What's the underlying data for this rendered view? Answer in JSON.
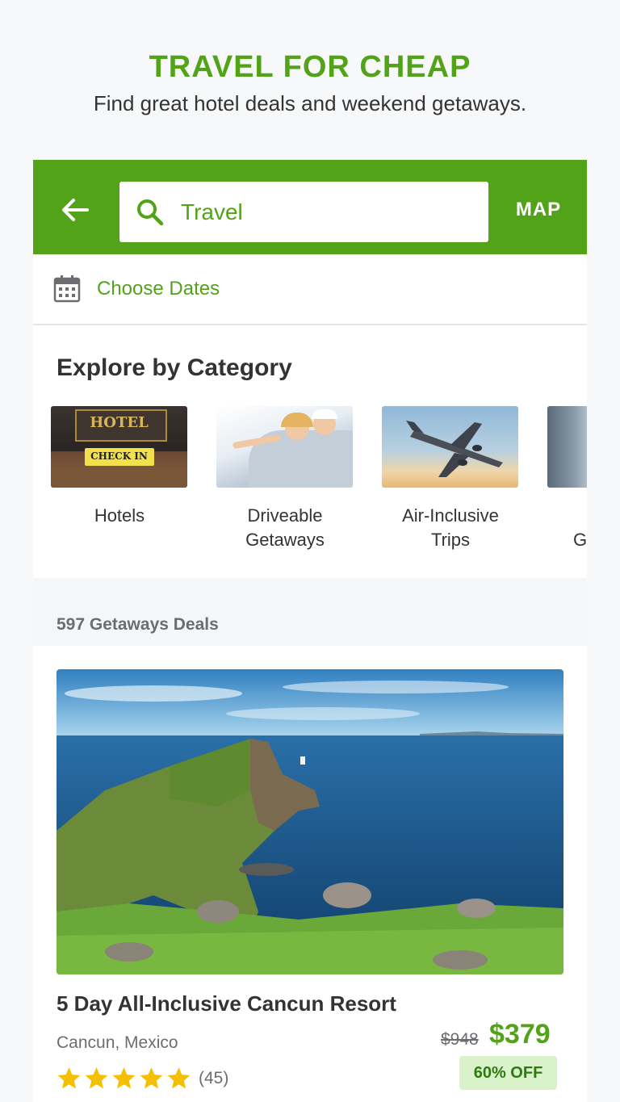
{
  "promo": {
    "title": "TRAVEL FOR CHEAP",
    "subtitle": "Find great hotel deals and weekend getaways."
  },
  "colors": {
    "brand_green": "#53a318",
    "badge_bg": "#d9f2c9",
    "star_yellow": "#f5c000"
  },
  "topbar": {
    "back_icon": "arrow-left-icon",
    "search_value": "Travel",
    "search_icon": "search-icon",
    "map_label": "MAP"
  },
  "dates": {
    "icon": "calendar-icon",
    "label": "Choose Dates"
  },
  "categories": {
    "title": "Explore by Category",
    "items": [
      {
        "label": "Hotels",
        "thumb_text_1": "HOTEL",
        "thumb_text_2": "CHECK IN"
      },
      {
        "label": "Driveable Getaways"
      },
      {
        "label": "Air-Inclusive Trips"
      },
      {
        "label": "G"
      }
    ]
  },
  "deals": {
    "count_label": "597 Getaways Deals",
    "card": {
      "title": "5 Day All-Inclusive Cancun Resort",
      "location": "Cancun, Mexico",
      "old_price": "$948",
      "new_price": "$379",
      "discount": "60% OFF",
      "rating": 5,
      "review_count": "(45)"
    }
  }
}
